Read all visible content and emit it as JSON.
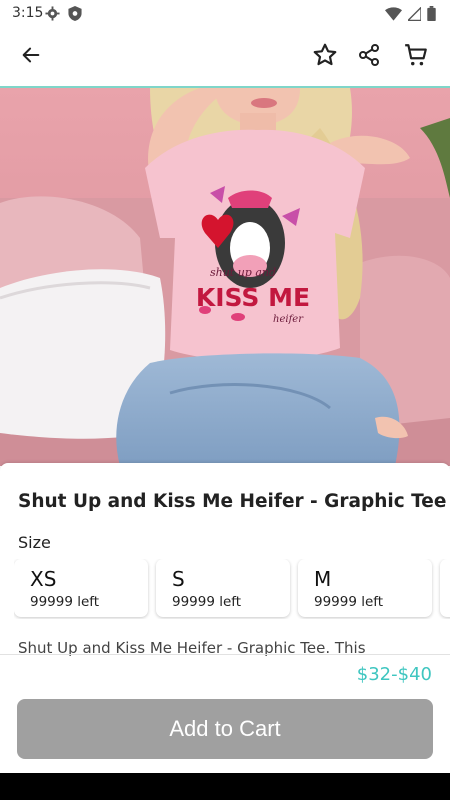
{
  "status_bar": {
    "time": "3:15"
  },
  "app_bar": {
    "back_icon": "arrow-left-icon",
    "favorite_icon": "star-icon",
    "share_icon": "share-icon",
    "cart_icon": "cart-icon"
  },
  "product": {
    "title": "Shut Up and Kiss Me Heifer - Graphic Tee",
    "size_label": "Size",
    "sizes": [
      {
        "name": "XS",
        "stock": "99999 left"
      },
      {
        "name": "S",
        "stock": "99999 left"
      },
      {
        "name": "M",
        "stock": "99999 left"
      }
    ],
    "description": "Shut Up and Kiss Me Heifer - Graphic Tee. This",
    "price": "$32-$40",
    "add_to_cart_label": "Add to Cart",
    "shirt_print": {
      "main": "KISS ME",
      "top_script": "shut up and",
      "bottom_script": "heifer"
    }
  },
  "colors": {
    "accent": "#3fc6c0",
    "accent_line": "#7fd6c9",
    "button_disabled": "#a0a0a0"
  }
}
